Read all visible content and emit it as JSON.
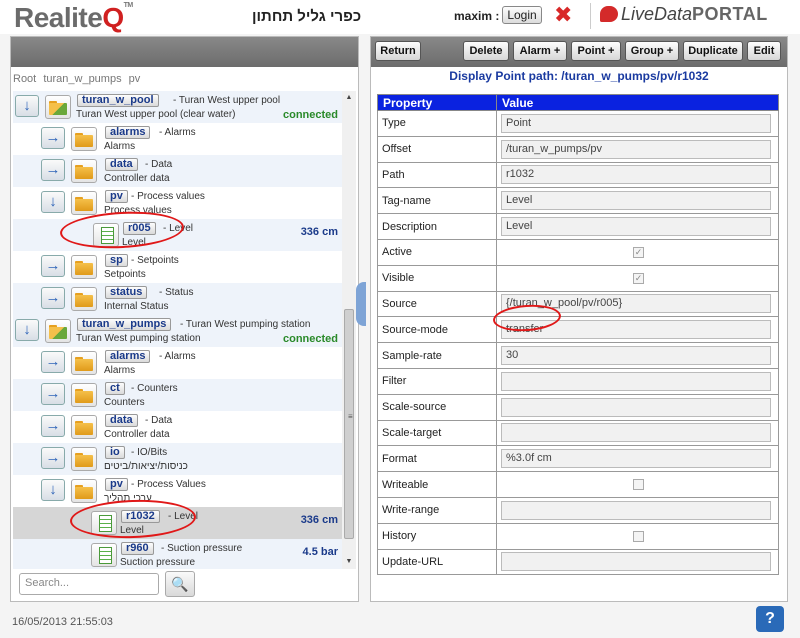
{
  "header": {
    "logo_main": "Realite",
    "logo_accent": "Q",
    "logo_tm": "TM",
    "site_name": "כפרי גליל תחתון",
    "user": "maxim :",
    "login_label": "Login",
    "close_glyph": "✖",
    "portal_live": "LiveData",
    "portal_word": "PORTAL"
  },
  "breadcrumb": [
    "Root",
    "turan_w_pumps",
    "pv"
  ],
  "tree": [
    {
      "tag": "turan_w_pool",
      "desc": "- Turan West upper pool",
      "sub": "Turan West upper pool (clear water)",
      "status": "connected",
      "arrow": "↓",
      "icon": "station"
    },
    {
      "tag": "alarms",
      "desc": "- Alarms",
      "sub": "Alarms",
      "arrow": "→",
      "icon": "folder"
    },
    {
      "tag": "data",
      "desc": "- Data",
      "sub": "Controller data",
      "arrow": "→",
      "icon": "folder"
    },
    {
      "tag": "pv",
      "desc": "- Process values",
      "sub": "Process values",
      "arrow": "↓",
      "icon": "folder"
    },
    {
      "tag": "r005",
      "desc": "- Level",
      "sub": "Level",
      "value": "336 cm",
      "icon": "doc"
    },
    {
      "tag": "sp",
      "desc": "- Setpoints",
      "sub": "Setpoints",
      "arrow": "→",
      "icon": "folder"
    },
    {
      "tag": "status",
      "desc": "- Status",
      "sub": "Internal Status",
      "arrow": "→",
      "icon": "folder"
    },
    {
      "tag": "turan_w_pumps",
      "desc": "- Turan West pumping station",
      "sub": "Turan West pumping station",
      "status": "connected",
      "arrow": "↓",
      "icon": "station"
    },
    {
      "tag": "alarms",
      "desc": "- Alarms",
      "sub": "Alarms",
      "arrow": "→",
      "icon": "folder"
    },
    {
      "tag": "ct",
      "desc": "- Counters",
      "sub": "Counters",
      "arrow": "→",
      "icon": "folder"
    },
    {
      "tag": "data",
      "desc": "- Data",
      "sub": "Controller data",
      "arrow": "→",
      "icon": "folder"
    },
    {
      "tag": "io",
      "desc": "- IO/Bits",
      "sub": "כניסות/יציאות/ביטים",
      "arrow": "→",
      "icon": "folder"
    },
    {
      "tag": "pv",
      "desc": "- Process Values",
      "sub": "ערכי תהליך",
      "arrow": "↓",
      "icon": "folder"
    },
    {
      "tag": "r1032",
      "desc": "- Level",
      "sub": "Level",
      "value": "336 cm",
      "icon": "doc"
    },
    {
      "tag": "r960",
      "desc": "- Suction pressure",
      "sub": "Suction pressure",
      "value": "4.5 bar",
      "icon": "doc"
    }
  ],
  "search": {
    "placeholder": "Search...",
    "icon": "magnifier-icon",
    "glyph": "🔍"
  },
  "scrollbar": {
    "up": "▲",
    "down": "▼",
    "grip": "≡"
  },
  "toolbar": {
    "return": "Return",
    "delete": "Delete",
    "alarm": "Alarm +",
    "point": "Point +",
    "group": "Group +",
    "duplicate": "Duplicate",
    "edit": "Edit"
  },
  "display_title": "Display Point path: /turan_w_pumps/pv/r1032",
  "table": {
    "col_property": "Property",
    "col_value": "Value",
    "rows": [
      {
        "k": "Type",
        "v": "Point"
      },
      {
        "k": "Offset",
        "v": "/turan_w_pumps/pv"
      },
      {
        "k": "Path",
        "v": "r1032"
      },
      {
        "k": "Tag-name",
        "v": "Level"
      },
      {
        "k": "Description",
        "v": "Level"
      },
      {
        "k": "Active",
        "check": true
      },
      {
        "k": "Visible",
        "check": true
      },
      {
        "k": "Source",
        "v": "{/turan_w_pool/pv/r005}"
      },
      {
        "k": "Source-mode",
        "v": "transfer"
      },
      {
        "k": "Sample-rate",
        "v": "30"
      },
      {
        "k": "Filter",
        "v": ""
      },
      {
        "k": "Scale-source",
        "v": ""
      },
      {
        "k": "Scale-target",
        "v": ""
      },
      {
        "k": "Format",
        "v": "%3.0f cm"
      },
      {
        "k": "Writeable",
        "check": false
      },
      {
        "k": "Write-range",
        "v": ""
      },
      {
        "k": "History",
        "check": false
      },
      {
        "k": "Update-URL",
        "v": ""
      }
    ]
  },
  "timestamp": "16/05/2013 21:55:03",
  "help_label": "?",
  "colors": {
    "header_blue": "#0a22e0",
    "connected": "#2a8a2a",
    "annotation": "#e01818"
  }
}
